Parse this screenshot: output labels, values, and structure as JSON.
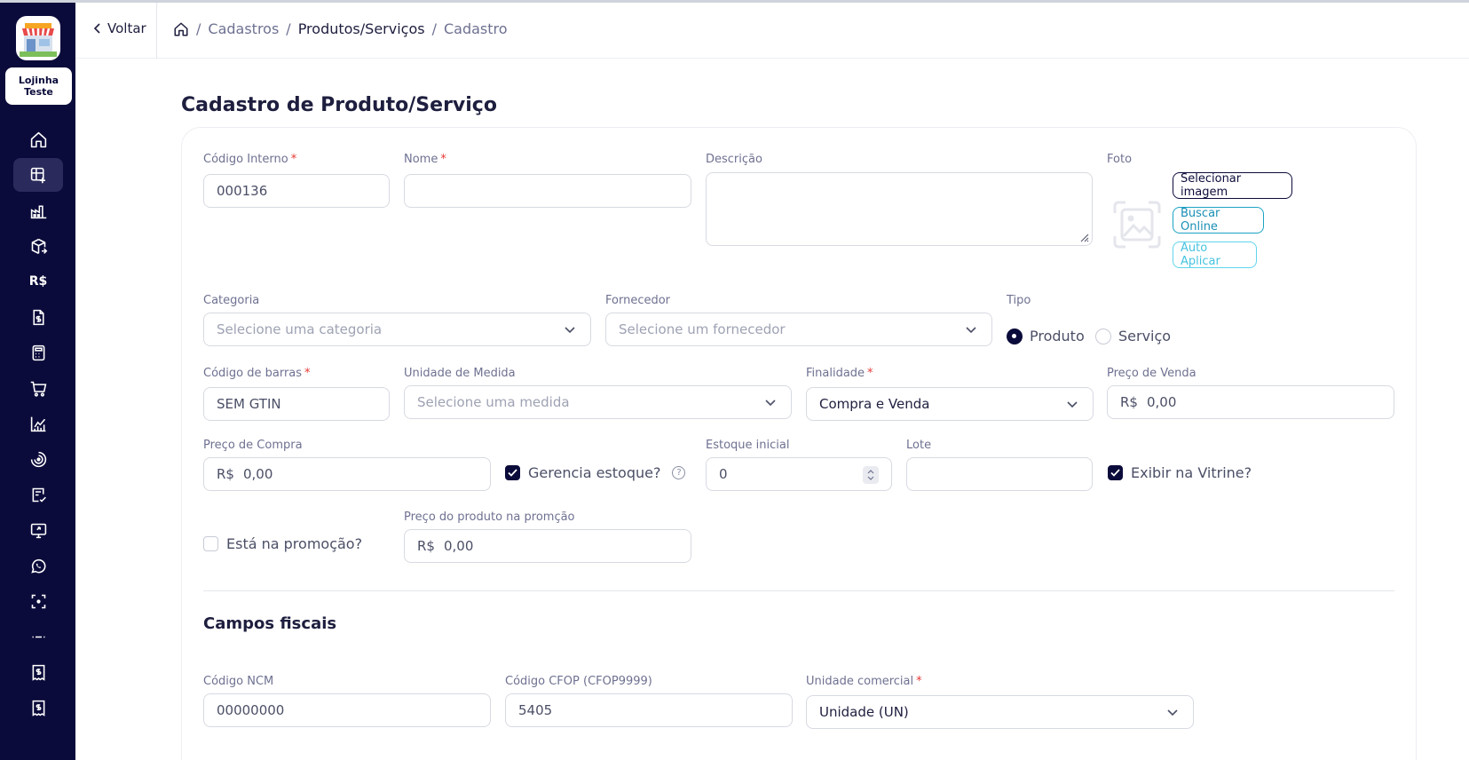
{
  "sidebar": {
    "store_name_line1": "Lojinha",
    "store_name_line2": "Teste",
    "icons": [
      "home-icon",
      "table-add-icon",
      "factory-icon",
      "box-arrow-icon",
      "currency-icon",
      "invoice-icon",
      "calculator-icon",
      "cart-icon",
      "chart-icon",
      "target-icon",
      "checklist-icon",
      "monitor-icon",
      "whatsapp-icon",
      "scan-icon",
      "ellipsis-icon",
      "receipt-icon",
      "receipt-2-icon"
    ],
    "currency_text": "R$"
  },
  "header": {
    "back_label": "Voltar",
    "breadcrumb": [
      "Cadastros",
      "Produtos/Serviços",
      "Cadastro"
    ],
    "separator": "/"
  },
  "page": {
    "title": "Cadastro de Produto/Serviço"
  },
  "form": {
    "codigo_interno": {
      "label": "Código Interno",
      "value": "000136"
    },
    "nome": {
      "label": "Nome",
      "value": ""
    },
    "descricao": {
      "label": "Descrição"
    },
    "foto": {
      "label": "Foto",
      "select_button": "Selecionar imagem",
      "search_button": "Buscar Online",
      "auto_button": "Auto Aplicar"
    },
    "categoria": {
      "label": "Categoria",
      "placeholder": "Selecione uma categoria"
    },
    "fornecedor": {
      "label": "Fornecedor",
      "placeholder": "Selecione um fornecedor"
    },
    "tipo": {
      "label": "Tipo",
      "options": [
        "Produto",
        "Serviço"
      ],
      "selected": "Produto"
    },
    "codigo_barras": {
      "label": "Código de barras",
      "value": "SEM GTIN"
    },
    "unidade_medida": {
      "label": "Unidade de Medida",
      "placeholder": "Selecione uma medida"
    },
    "finalidade": {
      "label": "Finalidade",
      "value": "Compra e Venda"
    },
    "preco_venda": {
      "label": "Preço de Venda",
      "prefix": "R$",
      "value": "0,00"
    },
    "preco_compra": {
      "label": "Preço de Compra",
      "prefix": "R$",
      "value": "0,00"
    },
    "gerencia_estoque": {
      "label": "Gerencia estoque?",
      "checked": true,
      "help": "?"
    },
    "estoque_inicial": {
      "label": "Estoque inicial",
      "value": "0"
    },
    "lote": {
      "label": "Lote",
      "value": ""
    },
    "exibir_vitrine": {
      "label": "Exibir na Vitrine?",
      "checked": true
    },
    "promocao": {
      "label": "Está na promoção?",
      "checked": false
    },
    "preco_promocao": {
      "label": "Preço do produto na promção",
      "prefix": "R$",
      "value": "0,00"
    }
  },
  "fiscal": {
    "title": "Campos fiscais",
    "ncm": {
      "label": "Código NCM",
      "value": "00000000"
    },
    "cfop": {
      "label": "Código CFOP (CFOP9999)",
      "value": "5405"
    },
    "unidade_comercial": {
      "label": "Unidade comercial",
      "value": "Unidade (UN)"
    }
  },
  "required_mark": "*",
  "colors": {
    "sidebar": "#0b0b3b",
    "required": "#e53935",
    "accent_blue": "#1a8fb5",
    "accent_cyan": "#45c3e0"
  }
}
